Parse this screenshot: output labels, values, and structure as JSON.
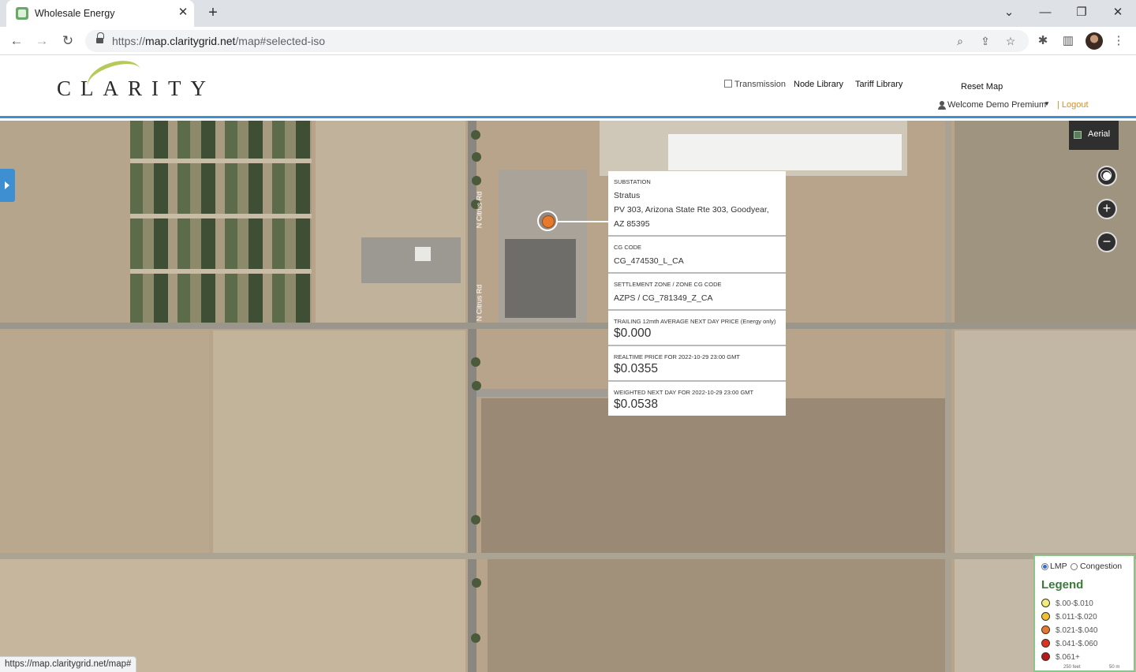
{
  "browser": {
    "tab_title": "Wholesale Energy",
    "url_host": "map.claritygrid.net",
    "url_scheme": "https://",
    "url_path": "/map#selected-iso",
    "status_url": "https://map.claritygrid.net/map#"
  },
  "header": {
    "logo_text": "CLARITY",
    "transmission_label": "Transmission",
    "node_library_label": "Node Library",
    "tariff_library_label": "Tariff Library",
    "reset_map_label": "Reset Map",
    "welcome_label": "Welcome Demo Premium",
    "logout_label": "| Logout"
  },
  "map": {
    "aerial_label": "Aerial",
    "road_label_1": "N Citrus Rd",
    "road_label_2": "N Citrus Rd"
  },
  "popup": {
    "substation_label": "SUBSTATION",
    "substation_name": "Stratus",
    "substation_address": "PV 303, Arizona State Rte 303, Goodyear, AZ 85395",
    "cg_code_label": "CG CODE",
    "cg_code": "CG_474530_L_CA",
    "zone_label": "SETTLEMENT ZONE / ZONE CG CODE",
    "zone_value": "AZPS / CG_781349_Z_CA",
    "trailing_label": "TRAILING 12mth AVERAGE NEXT DAY PRICE (Energy only)",
    "trailing_value": "$0.000",
    "realtime_label": "REALTIME PRICE FOR 2022-10-29 23:00 GMT",
    "realtime_value": "$0.0355",
    "weighted_label": "WEIGHTED NEXT DAY FOR 2022-10-29 23:00 GMT",
    "weighted_value": "$0.0538"
  },
  "legend": {
    "option_lmp": "LMP",
    "option_congestion": "Congestion",
    "title": "Legend",
    "items": [
      {
        "label": "$.00-$.010",
        "color": "#f4ec7a"
      },
      {
        "label": "$.011-$.020",
        "color": "#f0c030"
      },
      {
        "label": "$.021-$.040",
        "color": "#e8792a"
      },
      {
        "label": "$.041-$.060",
        "color": "#e03020"
      },
      {
        "label": "$.061+",
        "color": "#b81818"
      }
    ],
    "scale_label": "250 feet",
    "scale_label_2": "50 m"
  }
}
